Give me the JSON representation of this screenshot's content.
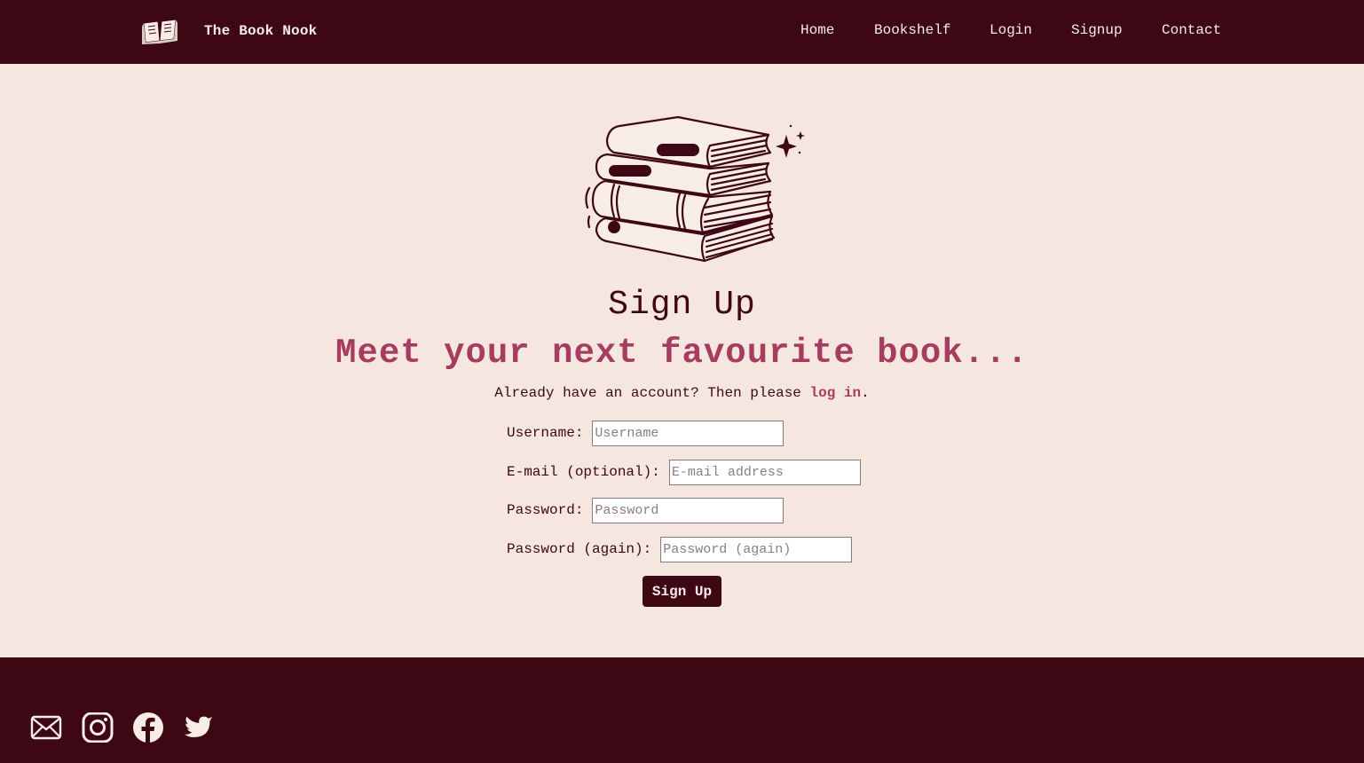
{
  "nav": {
    "brand_name": "The Book Nook",
    "logo_icon": "open-book-icon",
    "links": [
      "Home",
      "Bookshelf",
      "Login",
      "Signup",
      "Contact"
    ]
  },
  "hero": {
    "illustration": "stacked-books-icon"
  },
  "main": {
    "title": "Sign Up",
    "tagline": "Meet your next favourite book...",
    "already_text": "Already have an account? Then please ",
    "login_link": "log in",
    "already_suffix": "."
  },
  "form": {
    "username_label": "Username:",
    "username_placeholder": "Username",
    "email_label": "E-mail (optional):",
    "email_placeholder": "E-mail address",
    "password_label": "Password:",
    "password_placeholder": "Password",
    "password2_label": "Password (again):",
    "password2_placeholder": "Password (again)",
    "submit_label": "Sign Up"
  },
  "footer": {
    "social_icons": [
      "mail-icon",
      "instagram-icon",
      "facebook-icon",
      "twitter-icon"
    ]
  },
  "colors": {
    "primary_dark": "#3d0814",
    "background": "#f5e6df",
    "accent": "#a63d60",
    "light_text": "#f8ece6"
  }
}
